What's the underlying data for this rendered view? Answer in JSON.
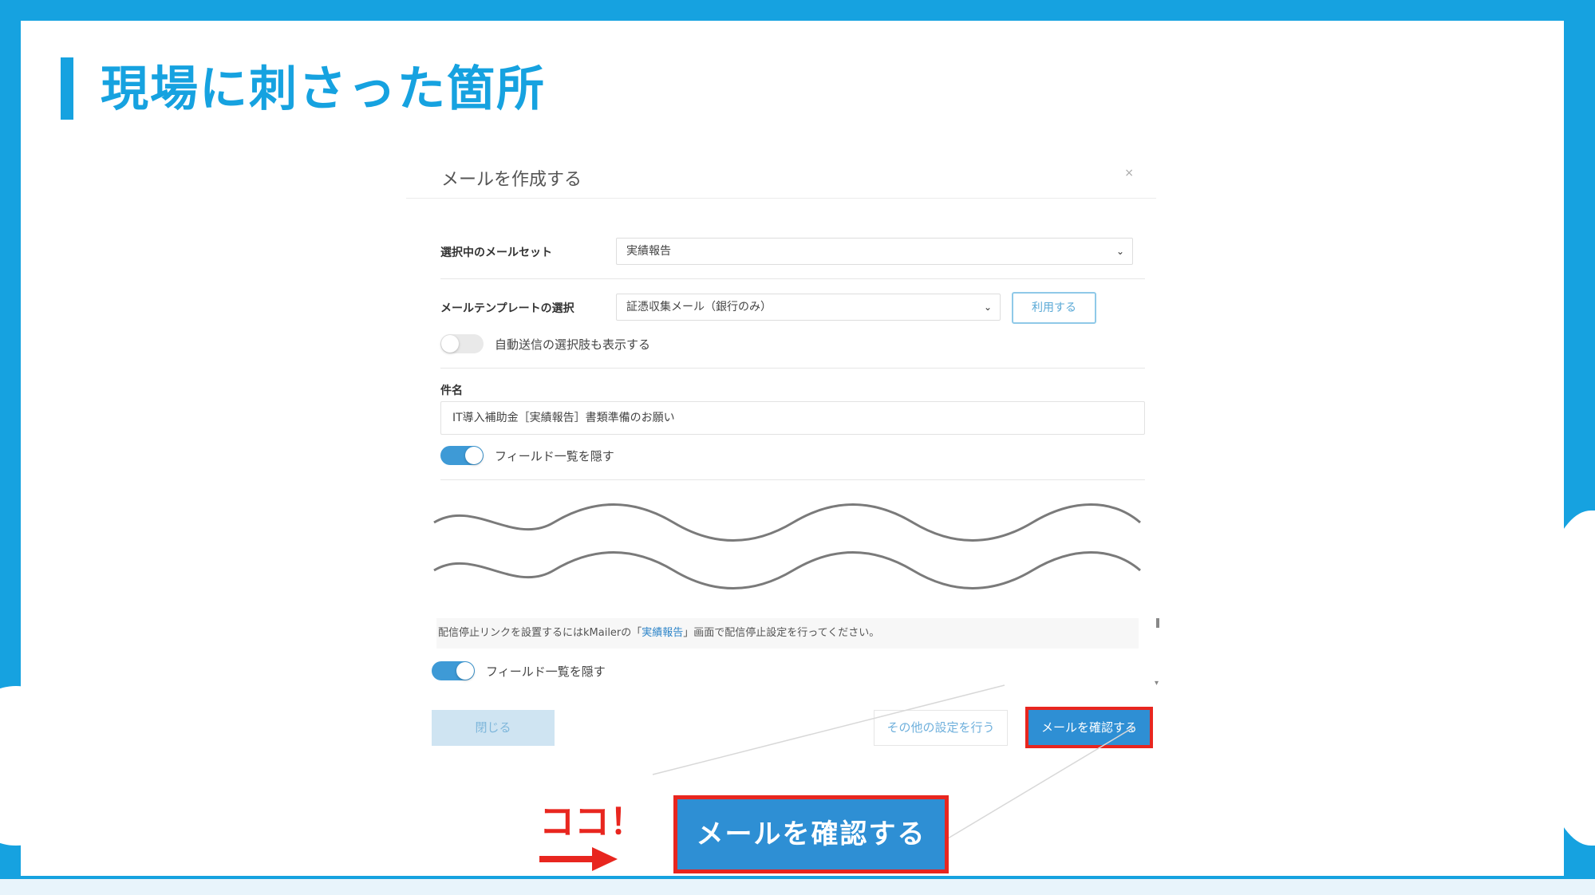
{
  "slide": {
    "title": "現場に刺さった箇所"
  },
  "modal": {
    "title": "メールを作成する",
    "close_icon": "×",
    "mailset": {
      "label": "選択中のメールセット",
      "value": "実績報告"
    },
    "template": {
      "label": "メールテンプレートの選択",
      "value": "証憑収集メール（銀行のみ）",
      "use_button": "利用する"
    },
    "auto_send_toggle": {
      "label": "自動送信の選択肢も表示する",
      "on": false
    },
    "subject": {
      "label": "件名",
      "value": "IT導入補助金［実績報告］書類準備のお願い"
    },
    "field_toggle_top": {
      "label": "フィールド一覧を隠す",
      "on": true
    },
    "note": {
      "prefix": "配信停止リンクを設置するにはkMailerの「",
      "link": "実績報告",
      "suffix": "」画面で配信停止設定を行ってください。"
    },
    "field_toggle_bottom": {
      "label": "フィールド一覧を隠す",
      "on": true
    },
    "buttons": {
      "close": "閉じる",
      "other_settings": "その他の設定を行う",
      "confirm": "メールを確認する"
    }
  },
  "callout": {
    "pointer_text": "ココ！",
    "button_label": "メールを確認する"
  },
  "colors": {
    "brand_blue": "#16a2e0",
    "button_blue": "#2e8fd4",
    "highlight_red": "#e8261f"
  }
}
